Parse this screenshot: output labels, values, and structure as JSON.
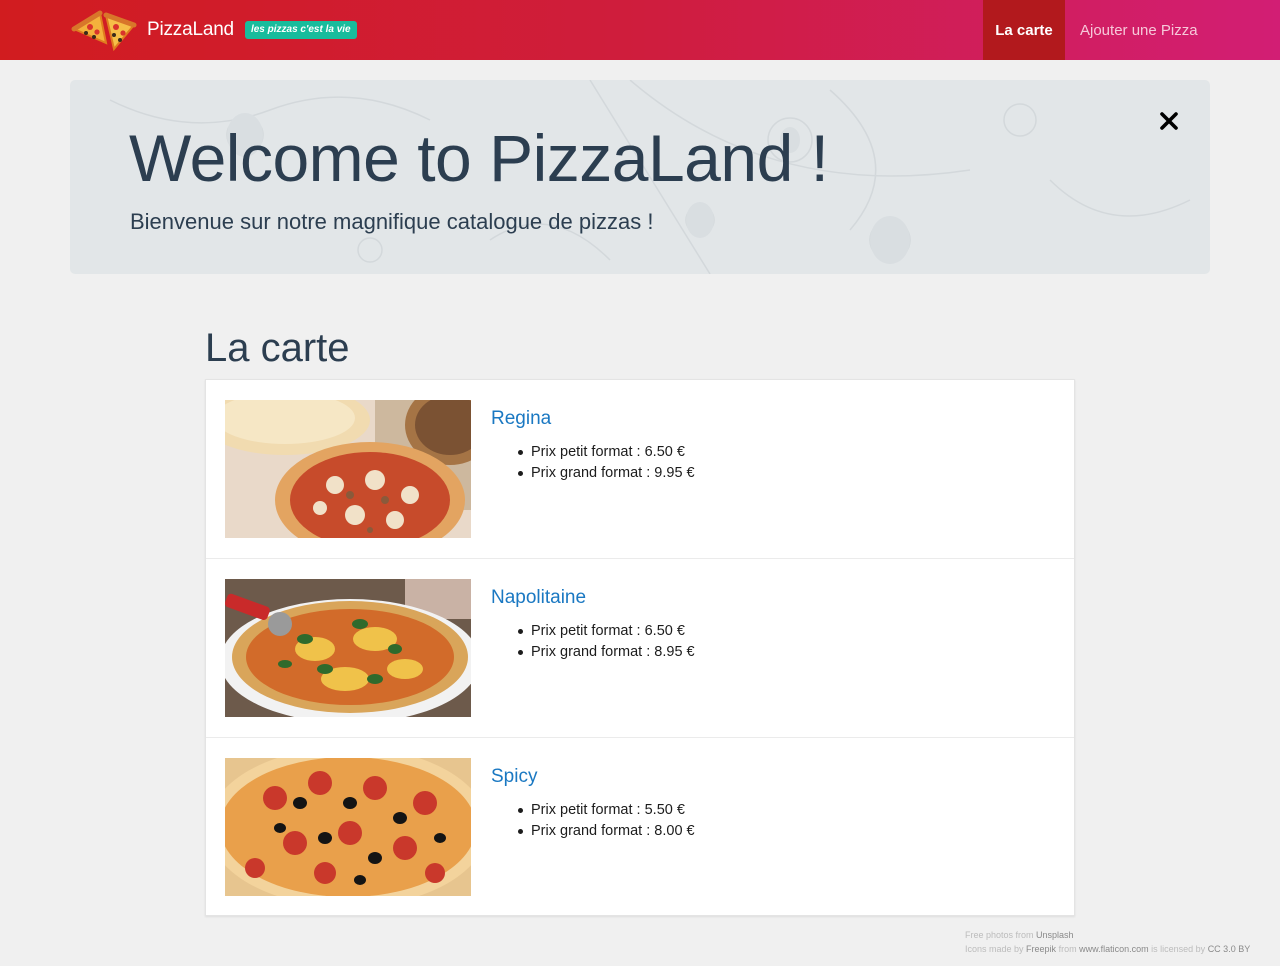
{
  "header": {
    "brand_name": "PizzaLand",
    "slogan": "les pizzas c'est la vie",
    "nav": [
      {
        "label": "La carte",
        "active": true
      },
      {
        "label": "Ajouter une Pizza",
        "active": false
      }
    ],
    "colors": {
      "gradient_start": "#d11c1f",
      "gradient_end": "#d21e74",
      "active": "#b2191d",
      "slogan_bg": "#18bc9c"
    }
  },
  "jumbotron": {
    "title": "Welcome to PizzaLand !",
    "subtitle": "Bienvenue sur notre magnifique catalogue de pizzas !",
    "close_icon": "close-icon"
  },
  "menu": {
    "title": "La carte",
    "items": [
      {
        "name": "Regina",
        "image_icon": "regina-pizza-photo",
        "small_price": "Prix petit format : 6.50 €",
        "large_price": "Prix grand format : 9.95 €"
      },
      {
        "name": "Napolitaine",
        "image_icon": "napolitaine-pizza-photo",
        "small_price": "Prix petit format : 6.50 €",
        "large_price": "Prix grand format : 8.95 €"
      },
      {
        "name": "Spicy",
        "image_icon": "spicy-pizza-photo",
        "small_price": "Prix petit format : 5.50 €",
        "large_price": "Prix grand format : 8.00 €"
      }
    ]
  },
  "footer": {
    "photos_prefix": "Free photos from",
    "photos_link": "Unsplash",
    "icons_prefix": "Icons made by",
    "icons_author": "Freepik",
    "from_word": "from",
    "icons_site": "www.flaticon.com",
    "license_prefix": "is licensed by",
    "license": "CC 3.0 BY"
  }
}
